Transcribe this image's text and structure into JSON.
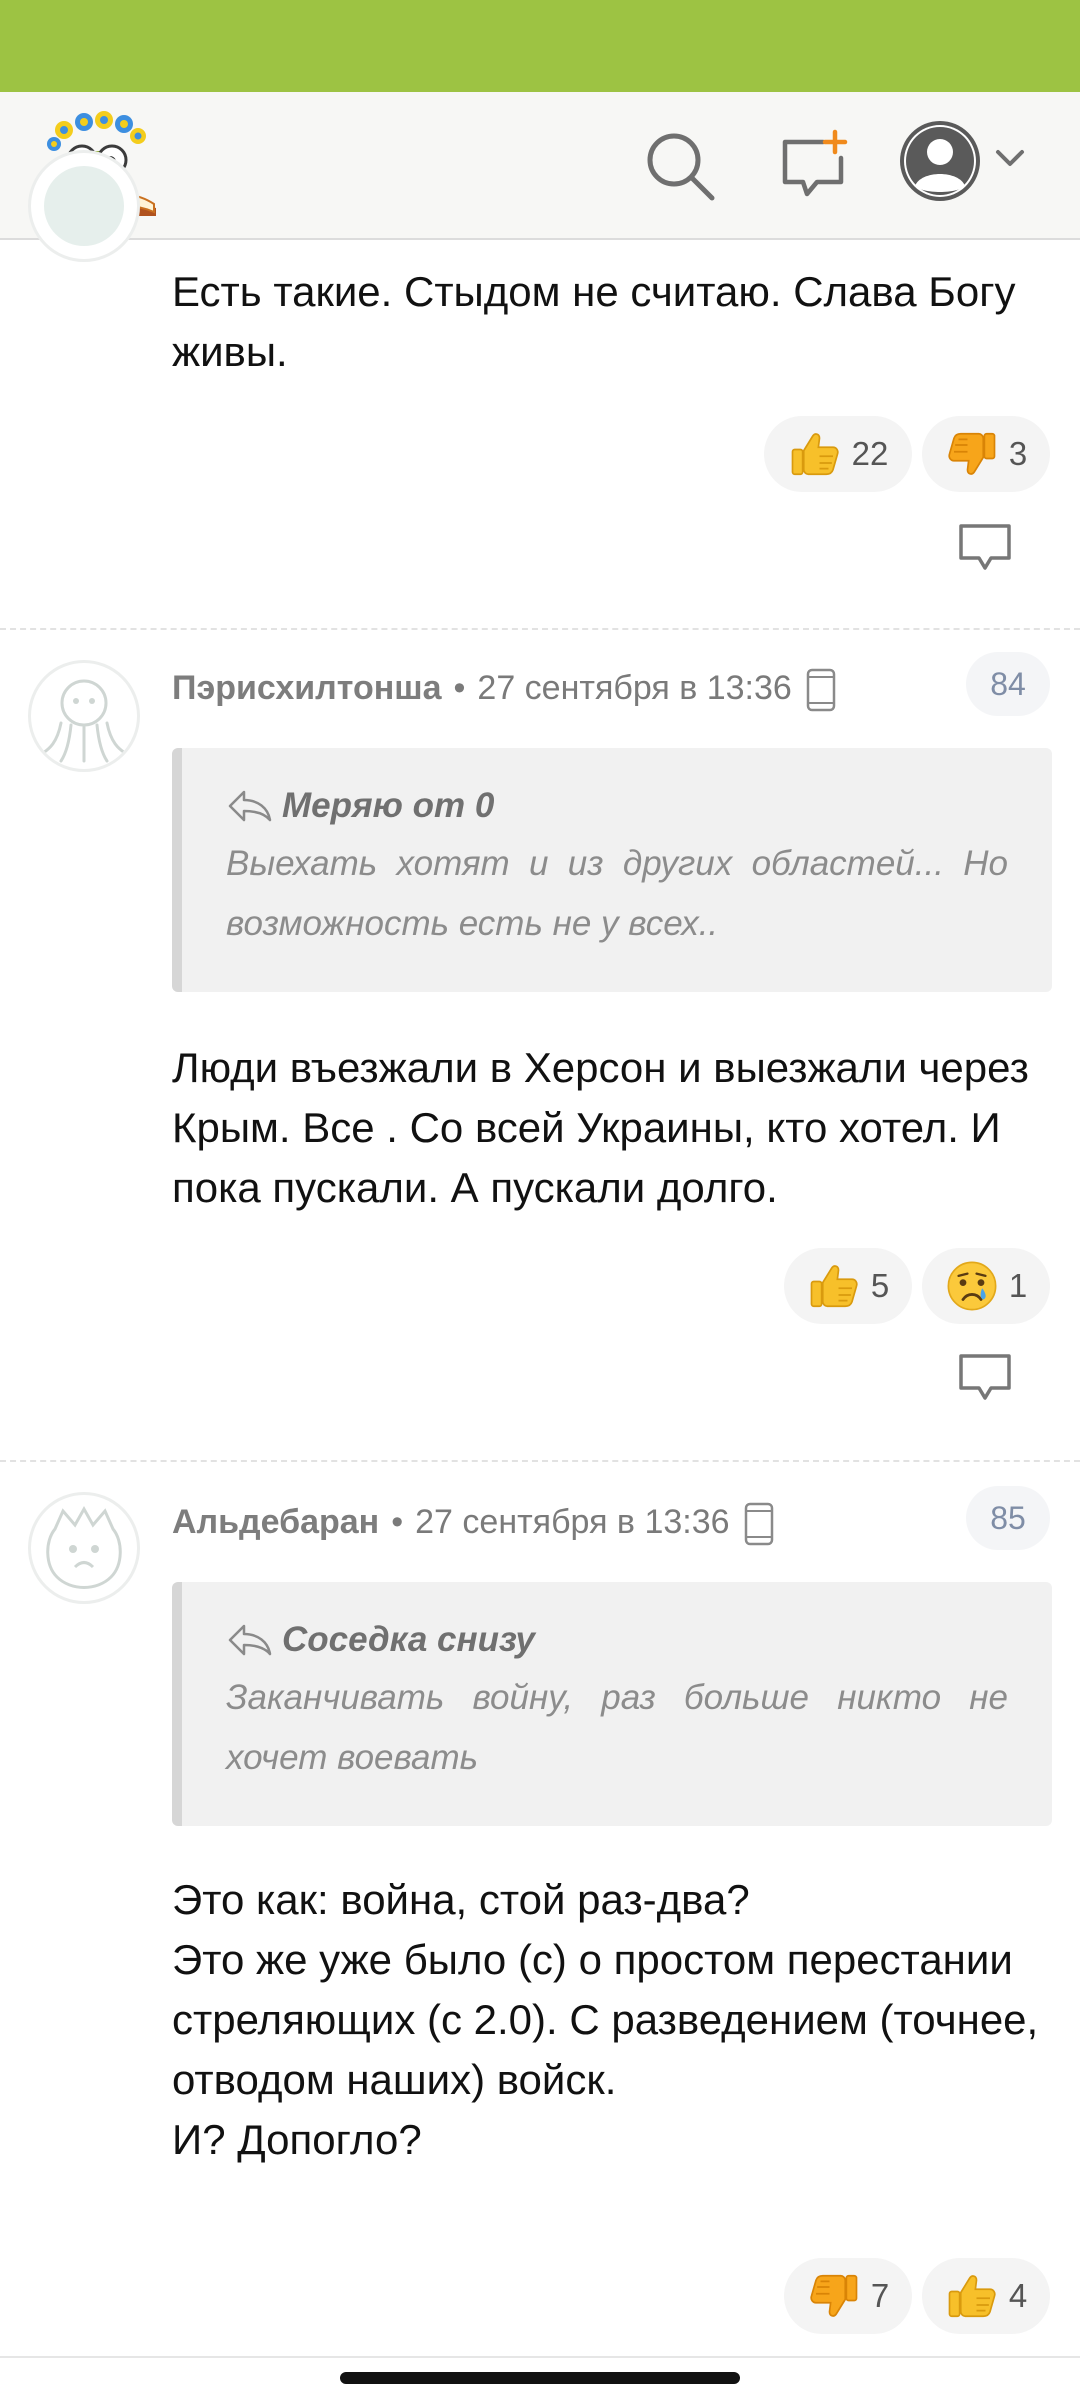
{
  "app": {
    "header_icons": [
      "logo-icon",
      "search-icon",
      "new-message-icon",
      "account-icon",
      "chevron-down-icon"
    ],
    "accent_color": "#9dc343"
  },
  "comments": [
    {
      "text": "Есть такие. Стыдом не считаю. Слава Богу живы.",
      "reactions": [
        {
          "icon": "thumbs-up-icon",
          "count": "22"
        },
        {
          "icon": "thumbs-down-icon",
          "count": "3"
        }
      ]
    },
    {
      "author": "Пэрисхилтонша",
      "date": "27 сентября в 13:36",
      "number": "84",
      "quote": {
        "author": "Меряю от 0",
        "text": "Выехать хотят и из других областей... Но возможность есть не у всех.."
      },
      "text": "Люди въезжали в Херсон и выезжали через Крым. Все . Со всей Украины, кто хотел. И пока пускали. А пускали долго.",
      "reactions": [
        {
          "icon": "thumbs-up-icon",
          "count": "5"
        },
        {
          "icon": "crying-face-icon",
          "count": "1"
        }
      ]
    },
    {
      "author": "Альдебаран",
      "date": "27 сентября в 13:36",
      "number": "85",
      "quote": {
        "author": "Соседка снизу",
        "text": "Заканчивать войну, раз больше никто не хочет воевать"
      },
      "text_lines": [
        "Это как: война, стой раз-два?",
        "Это же уже было (с) о простом перестании стреляющих (с 2.0). С разведением (точнее, отводом наших) войск.",
        "И? Допогло?"
      ],
      "reactions": [
        {
          "icon": "thumbs-down-icon",
          "count": "7"
        },
        {
          "icon": "thumbs-up-icon",
          "count": "4"
        }
      ]
    }
  ]
}
